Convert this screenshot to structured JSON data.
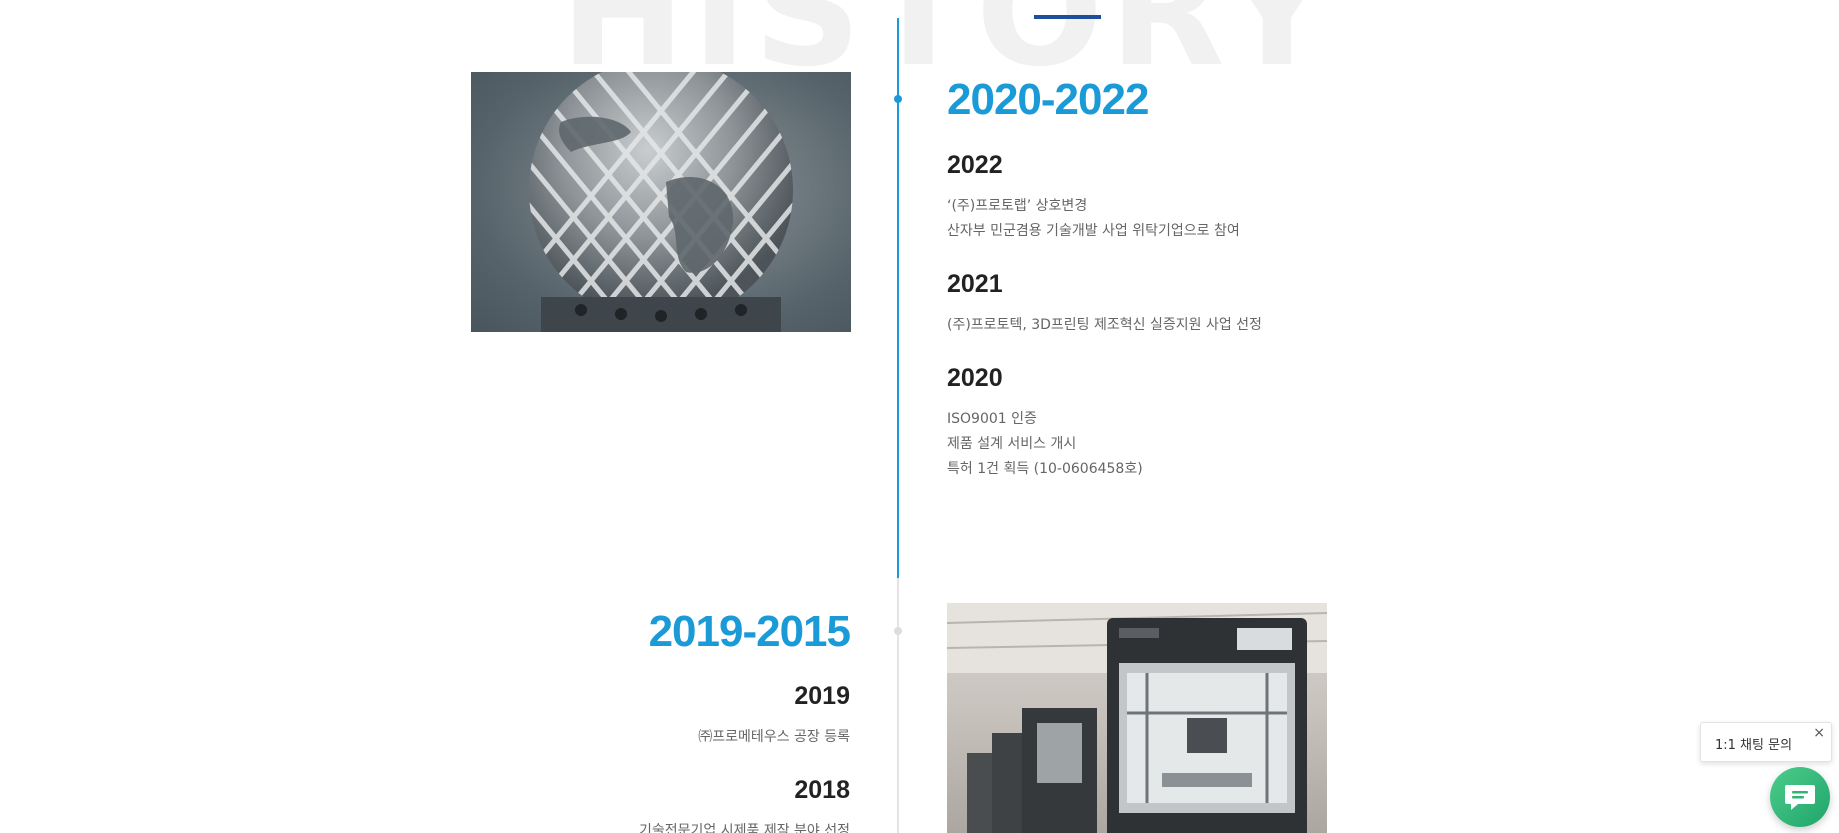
{
  "watermark": {
    "text": "HISTORY"
  },
  "periods": [
    {
      "title": "2020-2022",
      "entries": [
        {
          "year": "2022",
          "lines": [
            "‘(주)프로토랩’ 상호변경",
            "산자부 민군겸용 기술개발 사업 위탁기업으로 참여"
          ]
        },
        {
          "year": "2021",
          "lines": [
            "(주)프로토텍, 3D프린팅 제조혁신 실증지원 사업 선정"
          ]
        },
        {
          "year": "2020",
          "lines": [
            "ISO9001 인증",
            "제품 설계 서비스 개시",
            "특허 1건 획득 (10-0606458호)"
          ]
        }
      ],
      "image_icon": "metal-3d-printed-globe-image"
    },
    {
      "title": "2019-2015",
      "entries": [
        {
          "year": "2019",
          "lines": [
            "㈜프로메테우스 공장 등록"
          ]
        },
        {
          "year": "2018",
          "lines": [
            "기술전문기업 시제품 제작 분야 선정"
          ]
        }
      ],
      "image_icon": "3d-printer-lineup-image"
    }
  ],
  "chat": {
    "label": "1:1 채팅 문의",
    "close_symbol": "×",
    "button_icon": "chat-icon",
    "color": "#2bb673"
  },
  "colors": {
    "accent": "#1a9ad6",
    "top_accent": "#1f4e9a",
    "watermark": "#f1f1f1"
  }
}
